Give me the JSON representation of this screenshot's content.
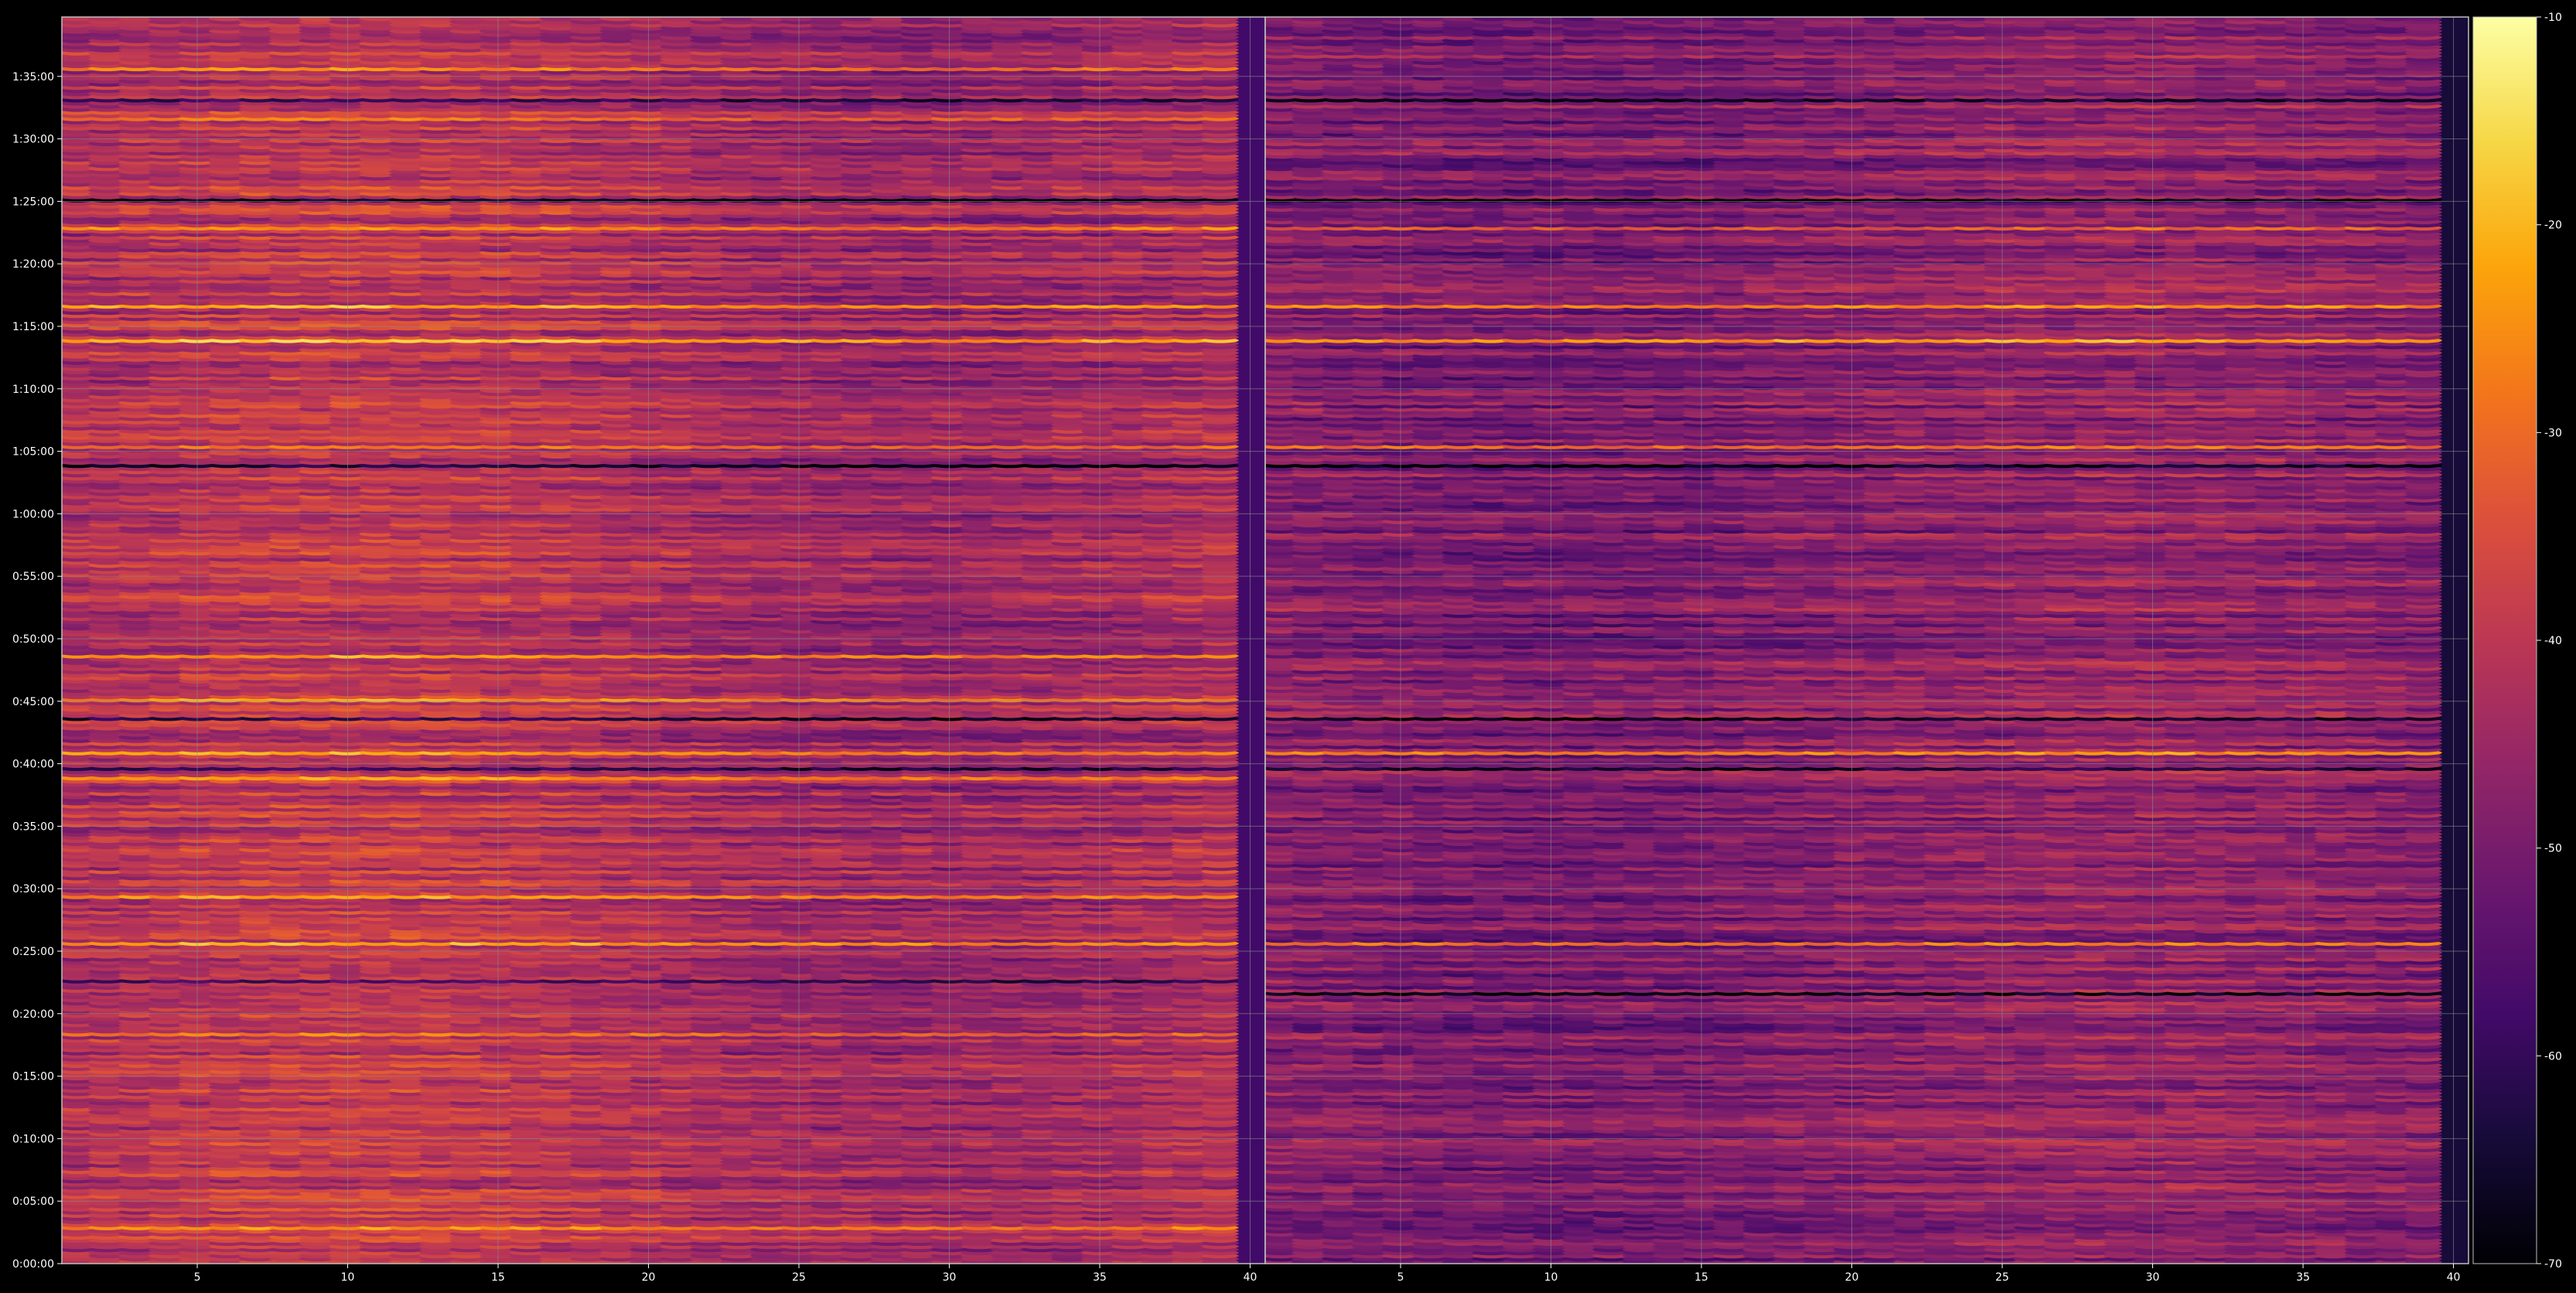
{
  "chart_data": {
    "type": "heatmap",
    "title": "",
    "colormap": "inferno",
    "background": "#000000",
    "grid": true,
    "grid_color": "#8c8c8c",
    "panels": [
      {
        "name": "left",
        "x_range": [
          1,
          40
        ],
        "x_ticks": [
          5,
          10,
          15,
          20,
          25,
          30,
          35,
          40
        ],
        "x_tick_labels": [
          "5",
          "10",
          "15",
          "20",
          "25",
          "30",
          "35",
          "40"
        ],
        "row_level_offset": 0,
        "bright_rows": [
          {
            "time": "1:13:45",
            "level": -21
          },
          {
            "time": "1:16:30",
            "level": -23
          },
          {
            "time": "0:25:30",
            "level": -23
          },
          {
            "time": "0:48:30",
            "level": -25
          },
          {
            "time": "0:40:45",
            "level": -24
          },
          {
            "time": "0:29:15",
            "level": -25
          },
          {
            "time": "1:22:45",
            "level": -26
          },
          {
            "time": "0:02:45",
            "level": -26
          },
          {
            "time": "0:38:45",
            "level": -26
          },
          {
            "time": "0:45:00",
            "level": -25
          },
          {
            "time": "1:35:30",
            "level": -28
          },
          {
            "time": "1:31:30",
            "level": -29
          },
          {
            "time": "1:05:15",
            "level": -30
          },
          {
            "time": "0:18:15",
            "level": -29
          }
        ],
        "dark_rows": [
          {
            "time": "1:25:00",
            "level": -70
          },
          {
            "time": "1:03:45",
            "level": -66
          },
          {
            "time": "0:43:30",
            "level": -63
          },
          {
            "time": "0:22:30",
            "level": -60
          },
          {
            "time": "1:33:00",
            "level": -62
          },
          {
            "time": "0:39:30",
            "level": -62
          }
        ]
      },
      {
        "name": "right",
        "x_range": [
          1,
          40
        ],
        "x_ticks": [
          5,
          10,
          15,
          20,
          25,
          30,
          35,
          40
        ],
        "x_tick_labels": [
          "5",
          "10",
          "15",
          "20",
          "25",
          "30",
          "35",
          "40"
        ],
        "row_level_offset": -6,
        "bright_rows": [
          {
            "time": "1:13:45",
            "level": -23
          },
          {
            "time": "1:16:30",
            "level": -26
          },
          {
            "time": "0:40:45",
            "level": -26
          },
          {
            "time": "0:25:30",
            "level": -28
          },
          {
            "time": "1:05:15",
            "level": -29
          },
          {
            "time": "1:22:45",
            "level": -32
          }
        ],
        "dark_rows": [
          {
            "time": "1:25:00",
            "level": -70
          },
          {
            "time": "1:03:45",
            "level": -68
          },
          {
            "time": "0:43:30",
            "level": -66
          },
          {
            "time": "0:21:30",
            "level": -68
          },
          {
            "time": "0:39:30",
            "level": -64
          },
          {
            "time": "1:33:00",
            "level": -66
          }
        ]
      }
    ],
    "y_range": [
      "0:00:00",
      "1:39:45"
    ],
    "y_ticks": [
      "0:00:00",
      "0:05:00",
      "0:10:00",
      "0:15:00",
      "0:20:00",
      "0:25:00",
      "0:30:00",
      "0:35:00",
      "0:40:00",
      "0:45:00",
      "0:50:00",
      "0:55:00",
      "1:00:00",
      "1:05:00",
      "1:10:00",
      "1:15:00",
      "1:20:00",
      "1:25:00",
      "1:30:00",
      "1:35:00"
    ],
    "colorbar": {
      "range": [
        -70,
        -10
      ],
      "ticks": [
        -10,
        -20,
        -30,
        -40,
        -50,
        -60,
        -70
      ],
      "tick_labels": [
        "-10",
        "-20",
        "-30",
        "-40",
        "-50",
        "-60",
        "-70"
      ]
    }
  }
}
